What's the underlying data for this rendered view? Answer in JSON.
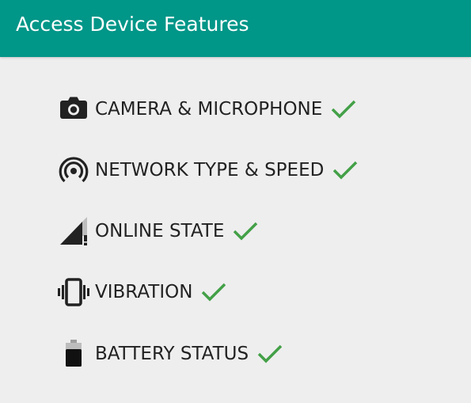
{
  "header": {
    "title": "Access Device Features",
    "color": "#009688"
  },
  "features": [
    {
      "icon": "camera-icon",
      "label": "CAMERA & MICROPHONE",
      "status": "check-icon"
    },
    {
      "icon": "network-icon",
      "label": "NETWORK TYPE & SPEED",
      "status": "check-icon"
    },
    {
      "icon": "signal-alert-icon",
      "label": "ONLINE STATE",
      "status": "check-icon"
    },
    {
      "icon": "vibration-icon",
      "label": "VIBRATION",
      "status": "check-icon"
    },
    {
      "icon": "battery-icon",
      "label": "BATTERY STATUS",
      "status": "check-icon"
    }
  ],
  "colors": {
    "background": "#eeeeee",
    "text": "#222222",
    "check": "#43a047"
  }
}
